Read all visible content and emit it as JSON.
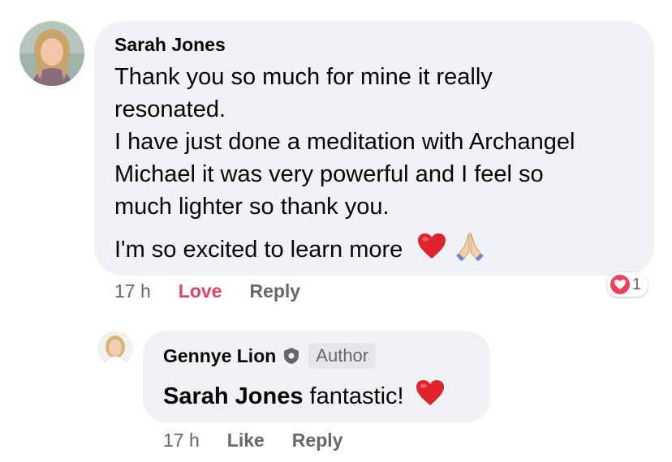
{
  "comment": {
    "author": "Sarah Jones",
    "lines": [
      "Thank you so much for mine it really",
      "resonated.",
      "I have just done a meditation with Archangel",
      "Michael it was very powerful and I feel so",
      "much lighter so thank you."
    ],
    "last_line": "I'm so excited to learn more",
    "time": "17 h",
    "love_label": "Love",
    "reply_label": "Reply",
    "reaction_count": "1",
    "colors": {
      "love": "#e4405f",
      "bubble": "#f0f2f5",
      "muted": "#65676b"
    }
  },
  "reply": {
    "author": "Gennye Lion",
    "badge": "Author",
    "mention": "Sarah Jones",
    "text": " fantastic!",
    "time": "17 h",
    "like_label": "Like",
    "reply_label": "Reply"
  }
}
